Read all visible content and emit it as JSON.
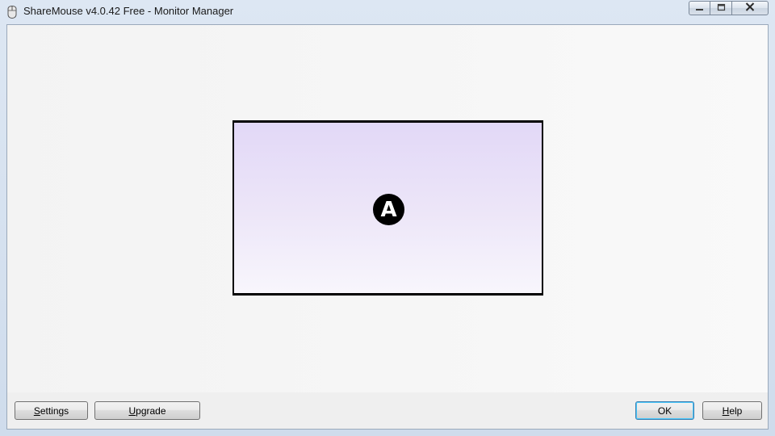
{
  "window": {
    "title": "ShareMouse v4.0.42 Free - Monitor Manager",
    "icons": {
      "app": "mouse-app-icon",
      "minimize": "minimize-icon",
      "maximize": "maximize-icon",
      "close": "close-icon"
    }
  },
  "monitors": [
    {
      "label": "A"
    }
  ],
  "buttons": {
    "settings": {
      "prefix": "",
      "accel": "S",
      "rest": "ettings"
    },
    "upgrade": {
      "prefix": "",
      "accel": "U",
      "rest": "pgrade"
    },
    "ok": {
      "label": "OK"
    },
    "help": {
      "prefix": "",
      "accel": "H",
      "rest": "elp"
    }
  },
  "colors": {
    "monitor_gradient_top": "#e2d8f7",
    "monitor_gradient_bottom": "#f8f6fc",
    "default_button_border": "#3c7fb1"
  }
}
